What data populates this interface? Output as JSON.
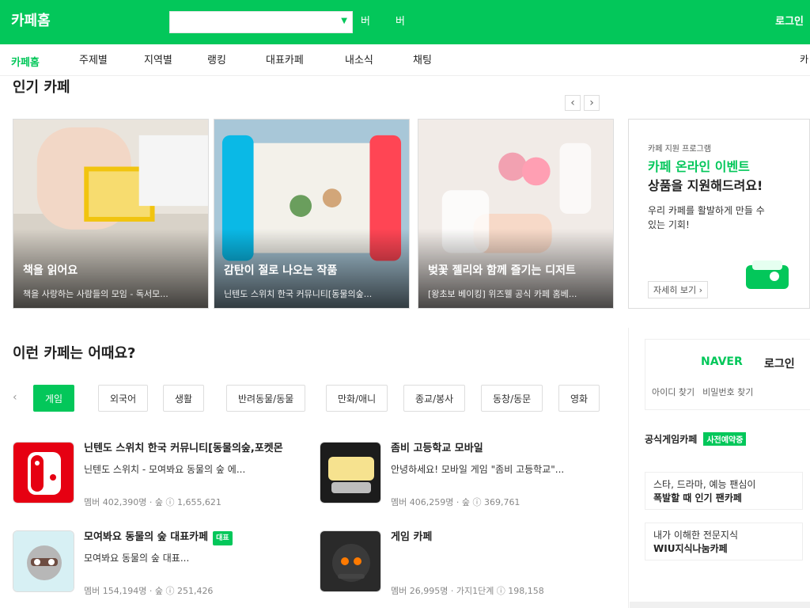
{
  "topbar": {
    "title": "카페홈",
    "search_placeholder": "",
    "btn1": "버",
    "btn2": "버",
    "right_btn": "로그인"
  },
  "nav": {
    "home": "카페홈",
    "items": [
      "주제별",
      "지역별",
      "랭킹",
      "대표카페",
      "내소식",
      "채팅"
    ],
    "right": "카"
  },
  "sec1": {
    "title": "인기 카페",
    "pager_prev": "‹",
    "pager_next": "›",
    "cards": [
      {
        "heading": "책을 읽어요",
        "sub": "책을 사랑하는 사람들의 모임 - 독서모..."
      },
      {
        "heading": "감탄이 절로 나오는 작품",
        "sub": "닌텐도 스위치 한국 커뮤니티[동물의숲..."
      },
      {
        "heading": "벚꽃 젤리와 함께 즐기는 디저트",
        "sub": "[왕초보 베이킹] 위즈웰 공식 카페 홈베..."
      }
    ]
  },
  "event": {
    "small": "카페 지원 프로그램",
    "t1": "카페 온라인 이벤트",
    "t2": "상품을 지원해드려요!",
    "t3": "우리 카페를 활발하게 만들 수 있는 기회!",
    "more": "자세히 보기 ›"
  },
  "sec2": {
    "title": "이런 카페는 어때요?",
    "tabs": [
      "게임",
      "외국어",
      "생활",
      "반려동물/동물",
      "만화/애니",
      "종교/봉사",
      "동창/동문",
      "영화"
    ],
    "prev": "‹",
    "list": [
      {
        "name": "닌텐도 스위치 한국 커뮤니티[동물의숲,포켓몬",
        "desc": "닌텐도 스위치 - 모여봐요 동물의 숲 에...",
        "meta": "멤버 402,390명 · 숲  ⓘ 1,655,621"
      },
      {
        "name": "좀비 고등학교 모바일",
        "desc": "안녕하세요! 모바일 게임 \"좀비 고등학교\"...",
        "meta": "멤버 406,259명 · 숲  ⓘ 369,761"
      },
      {
        "name": "모여봐요 동물의 숲 대표카페",
        "desc": "모여봐요 동물의 숲 대표...",
        "meta": "멤버 154,194명 · 숲  ⓘ 251,426"
      },
      {
        "name": "게임 카페",
        "desc": "",
        "meta": "멤버 26,995명 · 가지1단계  ⓘ 198,158"
      }
    ]
  },
  "side": {
    "naver": "NAVER",
    "login": "로그인",
    "find_id": "아이디 찾기",
    "find_pw": "비밀번호 찾기",
    "official": "공식게임카페",
    "official_tag": "사전예약중",
    "items": [
      {
        "l1": "스타, 드라마, 예능 팬심이",
        "l2": "폭발할 때 인기 팬카페"
      },
      {
        "l1": "내가 이해한 전문지식",
        "l2": "WIU지식나눔카페"
      }
    ]
  }
}
